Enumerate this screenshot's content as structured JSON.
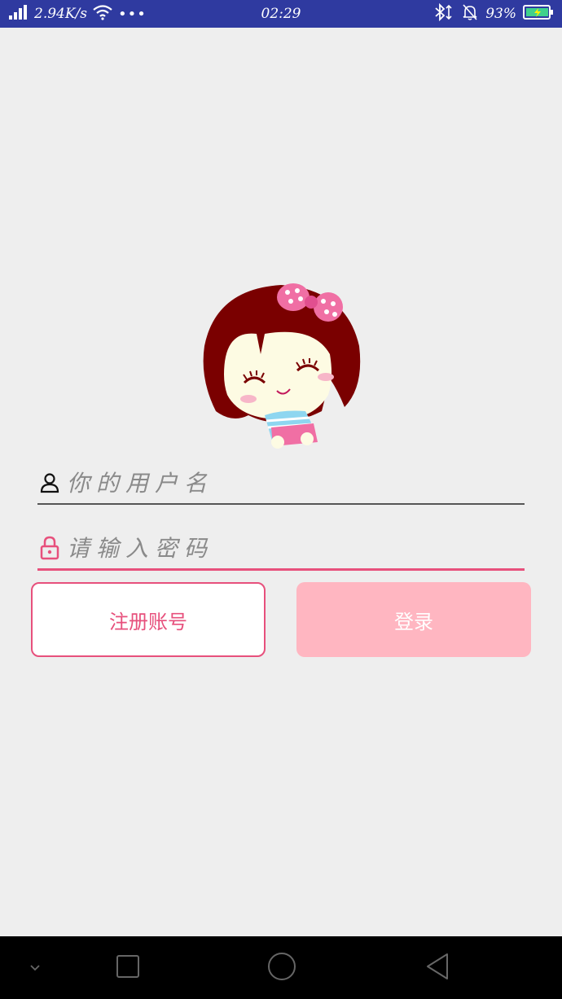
{
  "status_bar": {
    "net_speed": "2.94K/s",
    "more": "•••",
    "time": "02:29",
    "battery": "93%"
  },
  "form": {
    "username_placeholder": "你的用户名",
    "password_placeholder": "请输入密码"
  },
  "buttons": {
    "register_label": "注册账号",
    "login_label": "登录"
  },
  "colors": {
    "status_bar": "#2f3aa0",
    "accent": "#e7507c",
    "login_button": "#ffb6c1",
    "background": "#eeeeee"
  },
  "icons": {
    "username": "person-icon",
    "password": "lock-icon"
  }
}
